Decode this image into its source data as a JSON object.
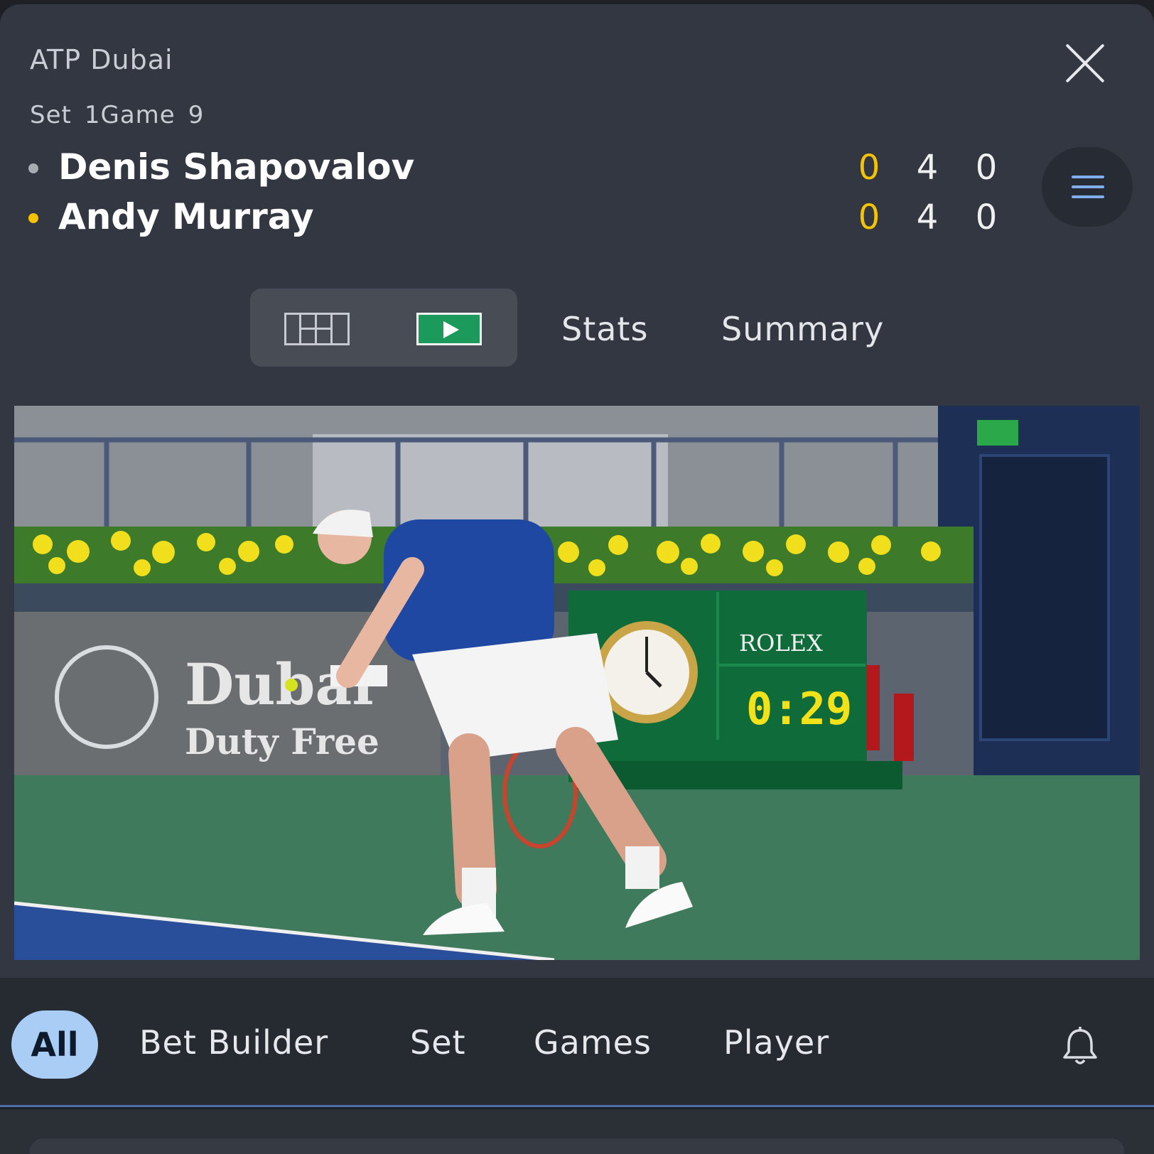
{
  "header": {
    "competition": "ATP Dubai",
    "period": {
      "set_label": "Set",
      "set_value": "1",
      "game_label": "Game",
      "game_value": "9"
    }
  },
  "players": [
    {
      "name": "Denis Shapovalov",
      "serving": false,
      "point": "0",
      "games": "4",
      "sets": "0"
    },
    {
      "name": "Andy Murray",
      "serving": true,
      "point": "0",
      "games": "4",
      "sets": "0"
    }
  ],
  "colors": {
    "accent_yellow": "#f5c400",
    "serve_dot_inactive": "#a7abb2",
    "video_button_green": "#1c9a5c",
    "chip_active": "#a9cdf5"
  },
  "view_tabs": {
    "court_icon": "court-grid-icon",
    "video_icon": "play-video-icon",
    "stats": "Stats",
    "summary": "Summary"
  },
  "video": {
    "board_brand": "ROLEX",
    "board_timer": "0:29",
    "banner_line1": "Dubai",
    "banner_line2": "Duty Free"
  },
  "filters": {
    "active": "All",
    "items": [
      "Bet Builder",
      "Set",
      "Games",
      "Player"
    ],
    "bell_icon": "bell-icon"
  }
}
